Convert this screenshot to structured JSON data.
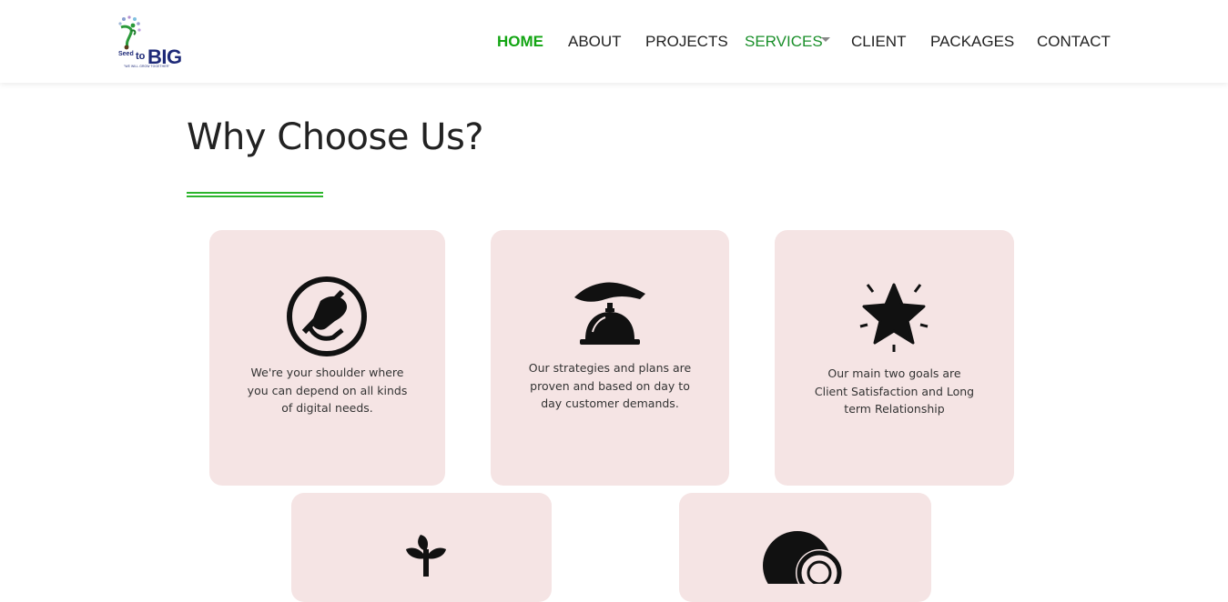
{
  "brand": {
    "name": "BIG",
    "seed": "Seed",
    "to": "to",
    "tagline": "\"WE WILL GROW TOGETHER\""
  },
  "nav": {
    "items": [
      {
        "label": "HOME"
      },
      {
        "label": "ABOUT"
      },
      {
        "label": "PROJECTS"
      },
      {
        "label": "SERVICES"
      },
      {
        "label": "CLIENT"
      },
      {
        "label": "PACKAGES"
      },
      {
        "label": "CONTACT"
      }
    ]
  },
  "section": {
    "title": "Why Choose Us?"
  },
  "cards": [
    {
      "icon": "handshake-icon",
      "text": "We're your shoulder where you can depend on all kinds of digital needs."
    },
    {
      "icon": "service-bell-icon",
      "text": "Our strategies and plans are proven and based on day to day customer demands."
    },
    {
      "icon": "star-icon",
      "text": "Our main two goals are Client Satisfaction and Long term Relationship"
    },
    {
      "icon": "plant-icon",
      "text": ""
    },
    {
      "icon": "coins-icon",
      "text": ""
    }
  ],
  "colors": {
    "accent_green": "#13a513",
    "card_bg": "#f5e4e4",
    "brand_navy": "#1e2a78"
  }
}
